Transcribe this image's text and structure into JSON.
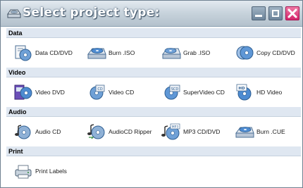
{
  "window": {
    "title": "Select project type:",
    "colors": {
      "title_text": "#ffffff",
      "close_button": "#d3246a",
      "section_bg": "#dfe7f1"
    }
  },
  "sections": [
    {
      "label": "Data",
      "items": [
        {
          "label": "Data CD/DVD",
          "icon": "data-disc-icon"
        },
        {
          "label": "Burn .ISO",
          "icon": "burn-iso-icon"
        },
        {
          "label": "Grab .ISO",
          "icon": "grab-iso-icon"
        },
        {
          "label": "Copy CD/DVD",
          "icon": "copy-disc-icon"
        }
      ]
    },
    {
      "label": "Video",
      "items": [
        {
          "label": "Video DVD",
          "icon": "video-dvd-icon"
        },
        {
          "label": "Video CD",
          "icon": "video-cd-icon"
        },
        {
          "label": "SuperVideo CD",
          "icon": "supervideo-cd-icon"
        },
        {
          "label": "HD Video",
          "icon": "hd-video-icon"
        }
      ]
    },
    {
      "label": "Audio",
      "items": [
        {
          "label": "Audio CD",
          "icon": "audio-cd-icon"
        },
        {
          "label": "AudioCD Ripper",
          "icon": "audiocd-ripper-icon"
        },
        {
          "label": "MP3 CD/DVD",
          "icon": "mp3-disc-icon"
        },
        {
          "label": "Burn .CUE",
          "icon": "burn-cue-icon"
        }
      ]
    },
    {
      "label": "Print",
      "items": [
        {
          "label": "Print Labels",
          "icon": "print-labels-icon"
        }
      ]
    }
  ]
}
